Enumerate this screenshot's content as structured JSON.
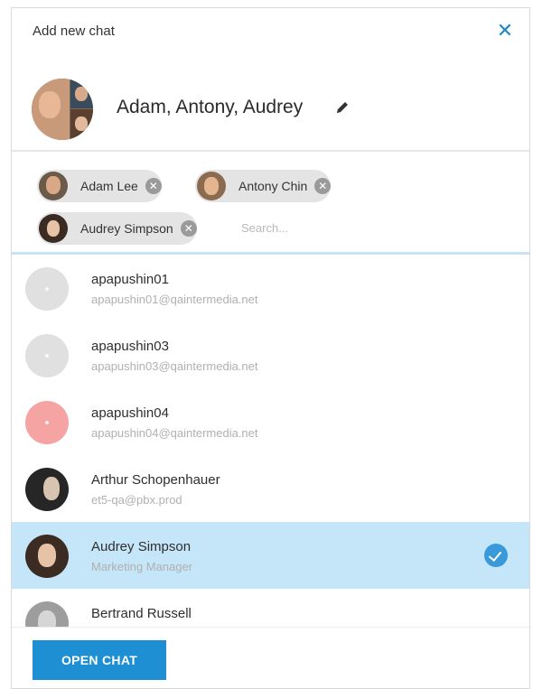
{
  "dialog": {
    "title": "Add new chat",
    "close_symbol": "✕"
  },
  "group": {
    "name": "Adam, Antony, Audrey",
    "edit_icon": "pencil-icon"
  },
  "chips": [
    {
      "label": "Adam Lee",
      "remove_symbol": "✕"
    },
    {
      "label": "Antony Chin",
      "remove_symbol": "✕"
    },
    {
      "label": "Audrey Simpson",
      "remove_symbol": "✕"
    }
  ],
  "search": {
    "placeholder": "Search..."
  },
  "contacts": [
    {
      "name": "apapushin01",
      "sub": "apapushin01@qaintermedia.net",
      "selected": false
    },
    {
      "name": "apapushin03",
      "sub": "apapushin03@qaintermedia.net",
      "selected": false
    },
    {
      "name": "apapushin04",
      "sub": "apapushin04@qaintermedia.net",
      "selected": false
    },
    {
      "name": "Arthur Schopenhauer",
      "sub": "et5-qa@pbx.prod",
      "selected": false
    },
    {
      "name": "Audrey Simpson",
      "sub": "Marketing Manager",
      "selected": true
    },
    {
      "name": "Bertrand Russell",
      "sub": "",
      "selected": false
    }
  ],
  "footer": {
    "open_chat_label": "OPEN CHAT"
  },
  "colors": {
    "accent": "#1e8fd2",
    "selected_row": "#c5e6f8",
    "chip_bg": "#e4e4e4",
    "placeholder_pink": "#f5a3a3"
  }
}
